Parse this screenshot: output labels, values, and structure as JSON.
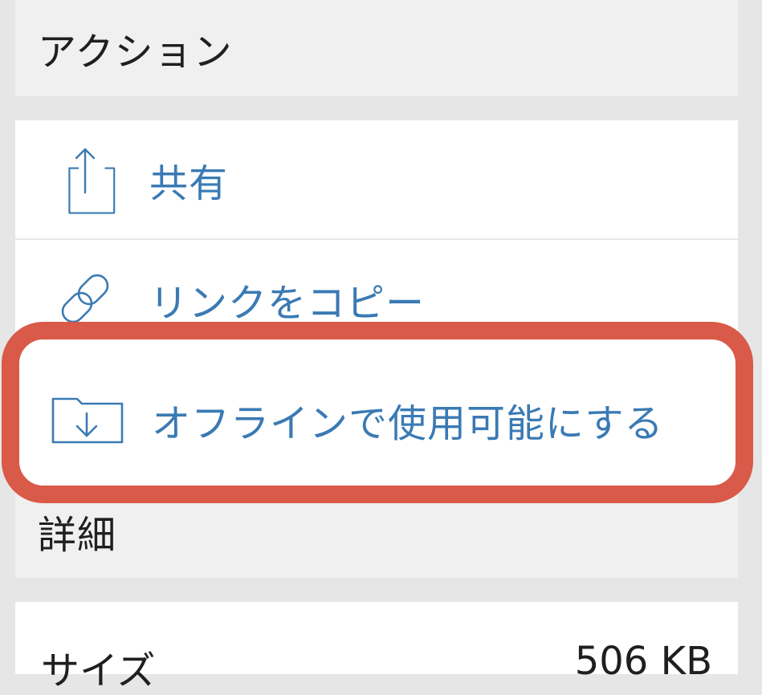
{
  "sections": {
    "actions_header": "アクション",
    "details_header": "詳細"
  },
  "actions": [
    {
      "label": "共有",
      "icon": "share-icon"
    },
    {
      "label": "リンクをコピー",
      "icon": "link-icon"
    },
    {
      "label": "オフラインで使用可能にする",
      "icon": "folder-download-icon"
    }
  ],
  "details": {
    "size_label": "サイズ",
    "size_value": "506 KB"
  },
  "colors": {
    "accent": "#3a7ab4",
    "highlight": "#d95a49",
    "background": "#e6e6e6",
    "header_bg": "#f0f0f0"
  }
}
